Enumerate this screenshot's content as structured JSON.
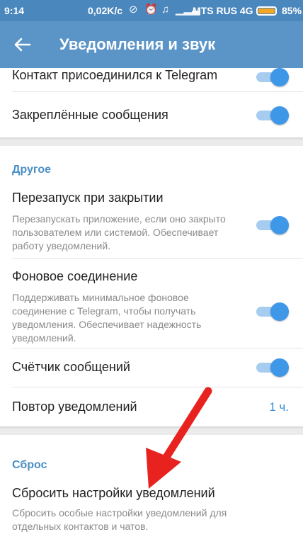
{
  "status_bar": {
    "time": "9:14",
    "speed": "0,02K/c",
    "carrier": "MTS RUS 4G",
    "battery_percent_text": "85%",
    "battery_level": 0.85,
    "battery_color": "#f5a623"
  },
  "app_bar": {
    "back_icon": "arrow-left-icon",
    "title": "Уведомления и звук",
    "color": "#5b95c7"
  },
  "accent_color": "#3f97e8",
  "top_section": {
    "contact_joined": {
      "label": "Контакт присоединился к Telegram",
      "enabled": true
    },
    "pinned_messages": {
      "label": "Закреплённые сообщения",
      "enabled": true
    }
  },
  "other_section": {
    "header": "Другое",
    "restart_on_close": {
      "label": "Перезапуск при закрытии",
      "description": "Перезапускать приложение, если оно закрыто пользователем или системой. Обеспечивает работу уведомлений.",
      "enabled": true
    },
    "background_connection": {
      "label": "Фоновое соединение",
      "description": "Поддерживать минимальное фоновое соединение с Telegram, чтобы получать уведомления. Обеспечивает надежность уведомлений.",
      "enabled": true
    },
    "badge_counter": {
      "label": "Счётчик сообщений",
      "enabled": true
    },
    "repeat_notifications": {
      "label": "Повтор уведомлений",
      "value": "1 ч."
    }
  },
  "reset_section": {
    "header": "Сброс",
    "reset_notifications": {
      "label": "Сбросить настройки уведомлений",
      "description": "Сбросить особые настройки уведомлений для отдельных контактов и чатов."
    }
  },
  "annotation": {
    "icon": "red-arrow-icon",
    "color": "#e8231f"
  }
}
